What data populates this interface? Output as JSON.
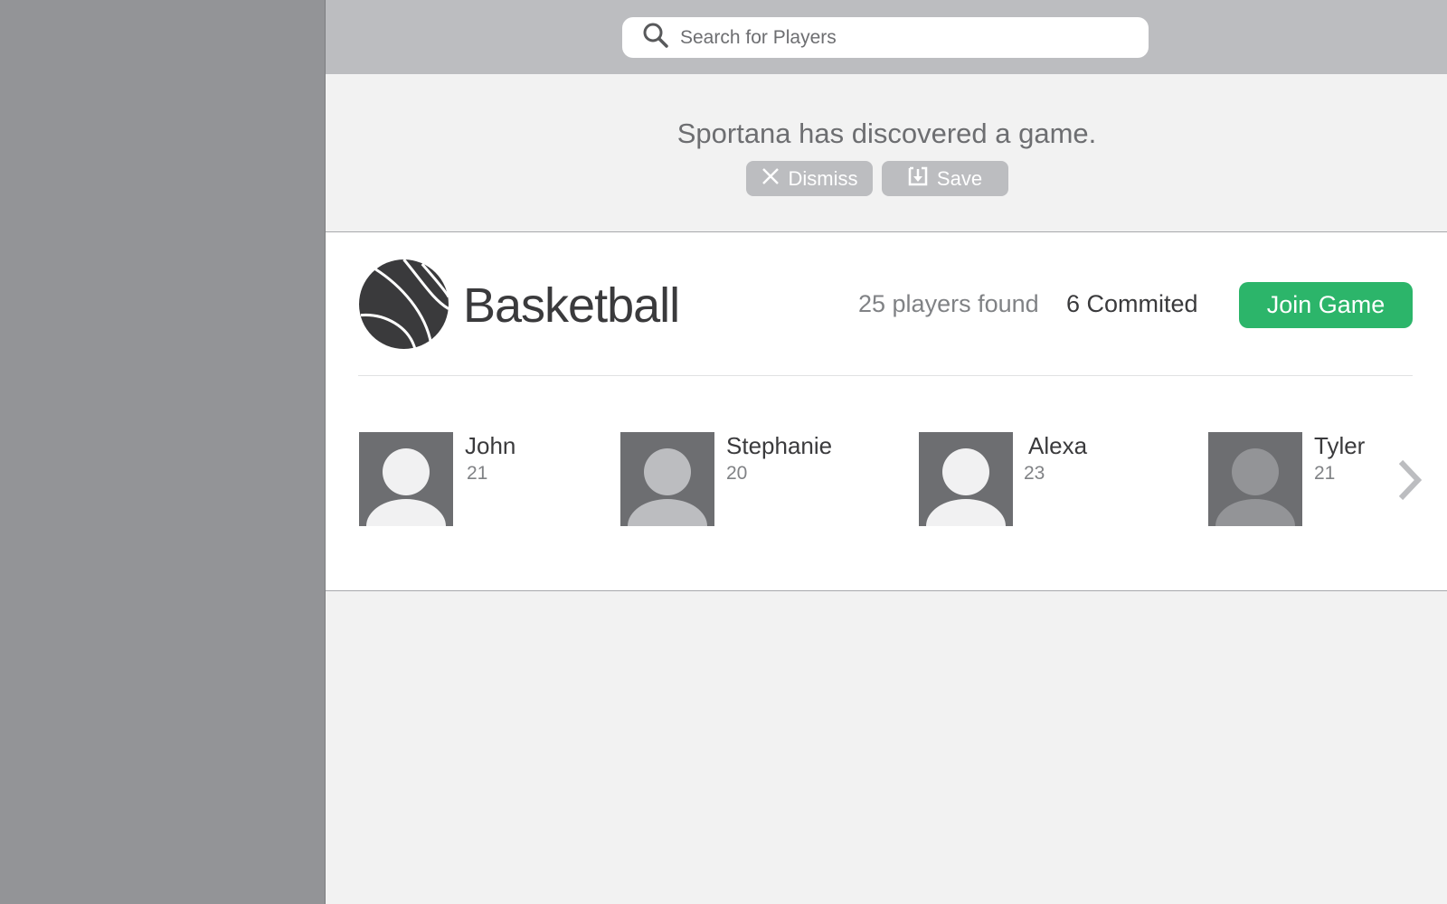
{
  "search": {
    "placeholder": "Search for Players",
    "icon": "search-icon"
  },
  "notice": {
    "message": "Sportana has discovered a game.",
    "dismiss_label": "Dismiss",
    "save_label": "Save",
    "dismiss_icon": "close-icon",
    "save_icon": "download-icon"
  },
  "game": {
    "sport": "Basketball",
    "sport_icon": "basketball-icon",
    "players_found": "25 players found",
    "committed": "6 Commited",
    "join_label": "Join Game",
    "accent_color": "#2cb56a"
  },
  "players": [
    {
      "name": "John",
      "age": "21",
      "avatar_color": "#6d6e71",
      "figure_color": "#f1f1f2"
    },
    {
      "name": "Stephanie",
      "age": "20",
      "avatar_color": "#6d6e71",
      "figure_color": "#bcbdc0"
    },
    {
      "name": "Alexa",
      "age": "23",
      "avatar_color": "#6d6e71",
      "figure_color": "#f1f1f2"
    },
    {
      "name": "Tyler",
      "age": "21",
      "avatar_color": "#6d6e71",
      "figure_color": "#939497"
    }
  ],
  "carousel": {
    "next_icon": "chevron-right-icon"
  }
}
